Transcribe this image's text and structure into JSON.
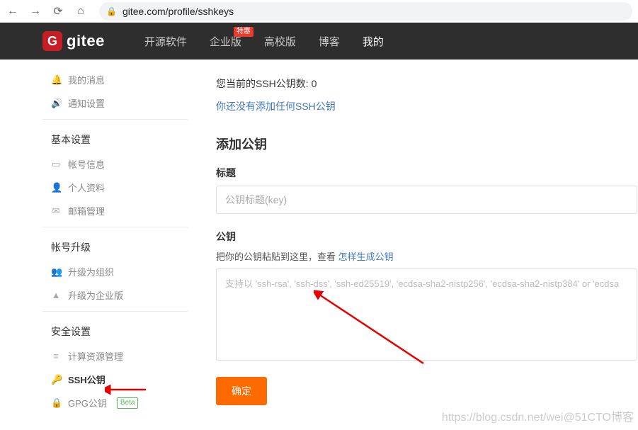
{
  "browser": {
    "url": "gitee.com/profile/sshkeys"
  },
  "nav": {
    "logo_text": "gitee",
    "items": [
      {
        "label": "开源软件",
        "active": false
      },
      {
        "label": "企业版",
        "active": false,
        "badge": "特惠"
      },
      {
        "label": "高校版",
        "active": false
      },
      {
        "label": "博客",
        "active": false
      },
      {
        "label": "我的",
        "active": true
      }
    ]
  },
  "sidebar": {
    "group0": {
      "items": [
        {
          "icon": "bell",
          "label": "我的消息"
        },
        {
          "icon": "volume",
          "label": "通知设置"
        }
      ]
    },
    "group1": {
      "title": "基本设置",
      "items": [
        {
          "icon": "id",
          "label": "帐号信息"
        },
        {
          "icon": "user",
          "label": "个人资料"
        },
        {
          "icon": "mail",
          "label": "邮箱管理"
        }
      ]
    },
    "group2": {
      "title": "帐号升级",
      "items": [
        {
          "icon": "group",
          "label": "升级为组织"
        },
        {
          "icon": "up",
          "label": "升级为企业版"
        }
      ]
    },
    "group3": {
      "title": "安全设置",
      "items": [
        {
          "icon": "list",
          "label": "计算资源管理"
        },
        {
          "icon": "key",
          "label": "SSH公钥",
          "active": true
        },
        {
          "icon": "lock",
          "label": "GPG公钥",
          "beta": "Beta"
        }
      ]
    }
  },
  "main": {
    "ssh_count_text": "您当前的SSH公钥数: 0",
    "no_keys_text": "你还没有添加任何SSH公钥",
    "add_key_title": "添加公钥",
    "title_label": "标题",
    "title_placeholder": "公钥标题(key)",
    "pubkey_label": "公钥",
    "pubkey_hint_prefix": "把你的公钥粘贴到这里，查看 ",
    "pubkey_hint_link": "怎样生成公钥",
    "pubkey_placeholder": "支持以 'ssh-rsa', 'ssh-dss', 'ssh-ed25519', 'ecdsa-sha2-nistp256', 'ecdsa-sha2-nistp384' or 'ecdsa",
    "submit_label": "确定"
  },
  "watermark": "https://blog.csdn.net/wei@51CTO博客"
}
